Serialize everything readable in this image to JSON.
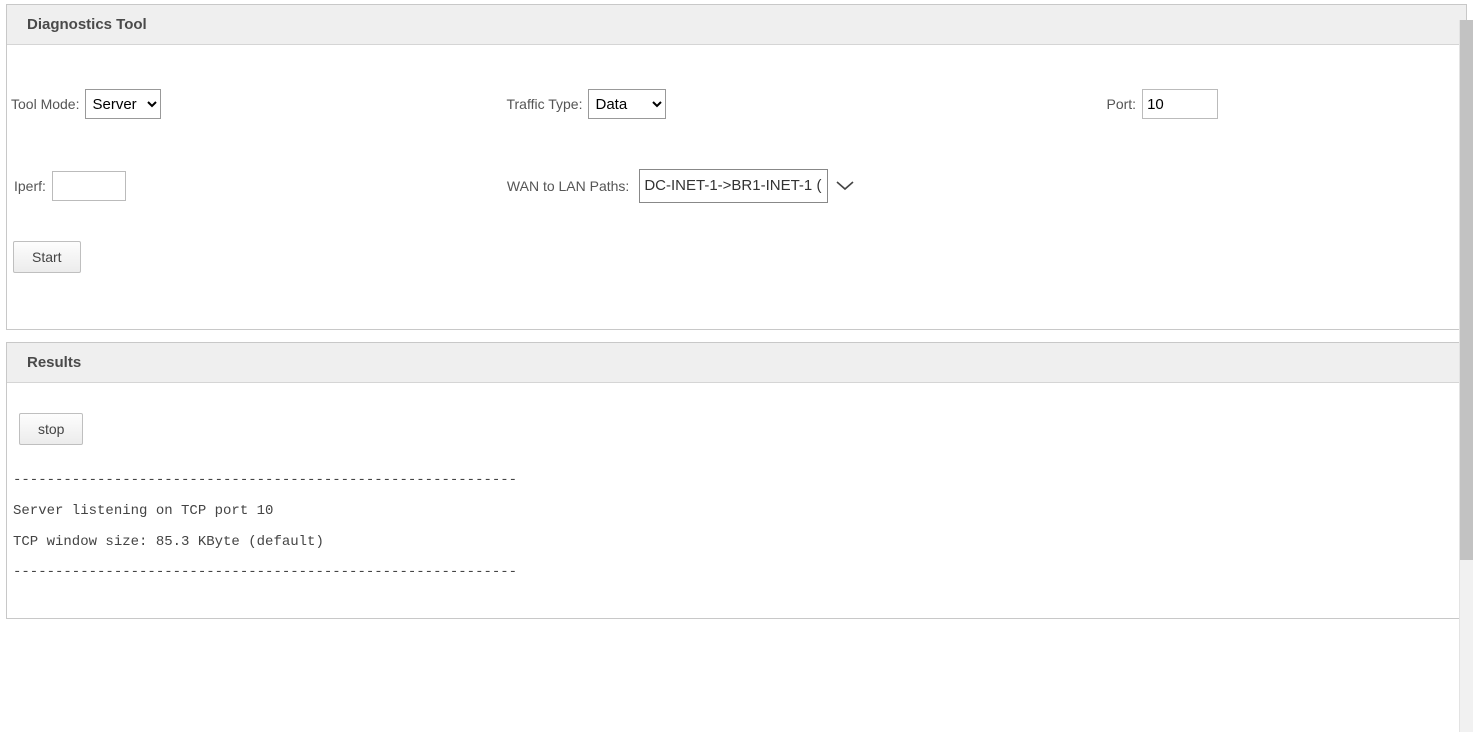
{
  "tool_panel": {
    "title": "Diagnostics Tool",
    "tool_mode": {
      "label": "Tool Mode:",
      "value": "Server"
    },
    "traffic_type": {
      "label": "Traffic Type:",
      "value": "Data"
    },
    "port": {
      "label": "Port:",
      "value": "10"
    },
    "iperf": {
      "label": "Iperf:",
      "value": ""
    },
    "wan_lan_paths": {
      "label": "WAN to LAN Paths:",
      "value": "DC-INET-1->BR1-INET-1 ("
    },
    "start_label": "Start"
  },
  "results_panel": {
    "title": "Results",
    "stop_label": "stop",
    "output": "------------------------------------------------------------\nServer listening on TCP port 10\nTCP window size: 85.3 KByte (default)\n------------------------------------------------------------"
  }
}
